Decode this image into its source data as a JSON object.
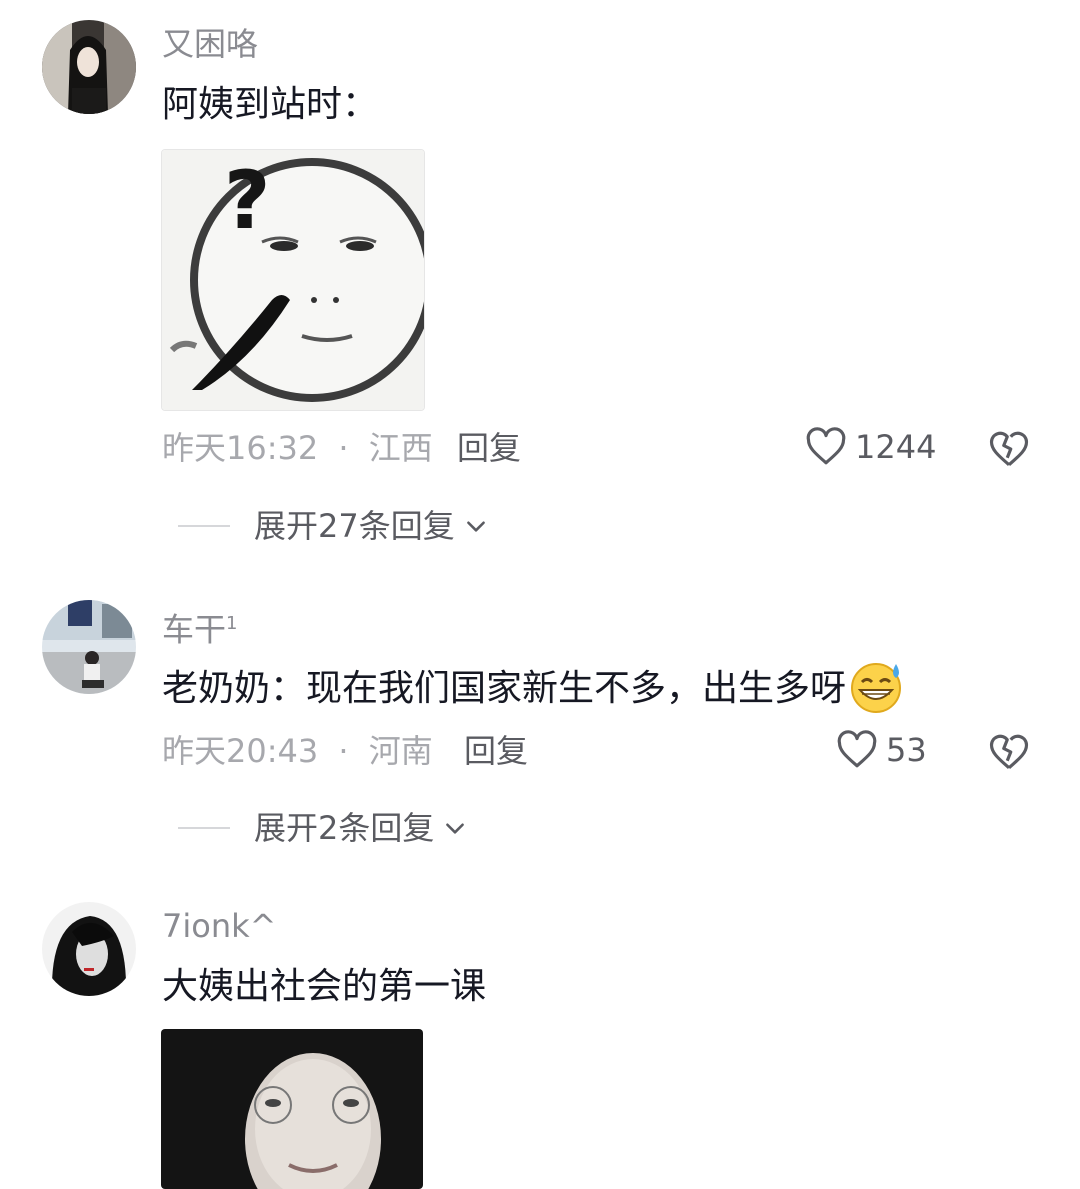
{
  "comments": [
    {
      "username": "又困咯",
      "text": "阿姨到站时：",
      "time": "昨天16:32",
      "sep": "·",
      "location": "江西",
      "reply_label": "回复",
      "likes": "1244",
      "expand_label": "展开27条回复",
      "avatar_icon": "avatar-girl-dark-hair",
      "image_icon": "confused-face-sticker"
    },
    {
      "username": "车干",
      "username_sup": "1",
      "text": "老奶奶：现在我们国家新生不多，出生多呀",
      "emoji_icon": "grinning-sweat-emoji",
      "time": "昨天20:43",
      "sep": "·",
      "location": "河南",
      "reply_label": "回复",
      "likes": "53",
      "expand_label": "展开2条回复",
      "avatar_icon": "avatar-man-street"
    },
    {
      "username": "7ionk^",
      "text": "大姨出社会的第一课",
      "avatar_icon": "avatar-dark-portrait",
      "image_icon": "face-looking-up-photo"
    }
  ],
  "colors": {
    "background": "#ffffff",
    "primary_text": "#161823",
    "secondary_text": "#8a8b91",
    "meta_text": "#a7a8ad",
    "action_text": "#5a5b61"
  }
}
